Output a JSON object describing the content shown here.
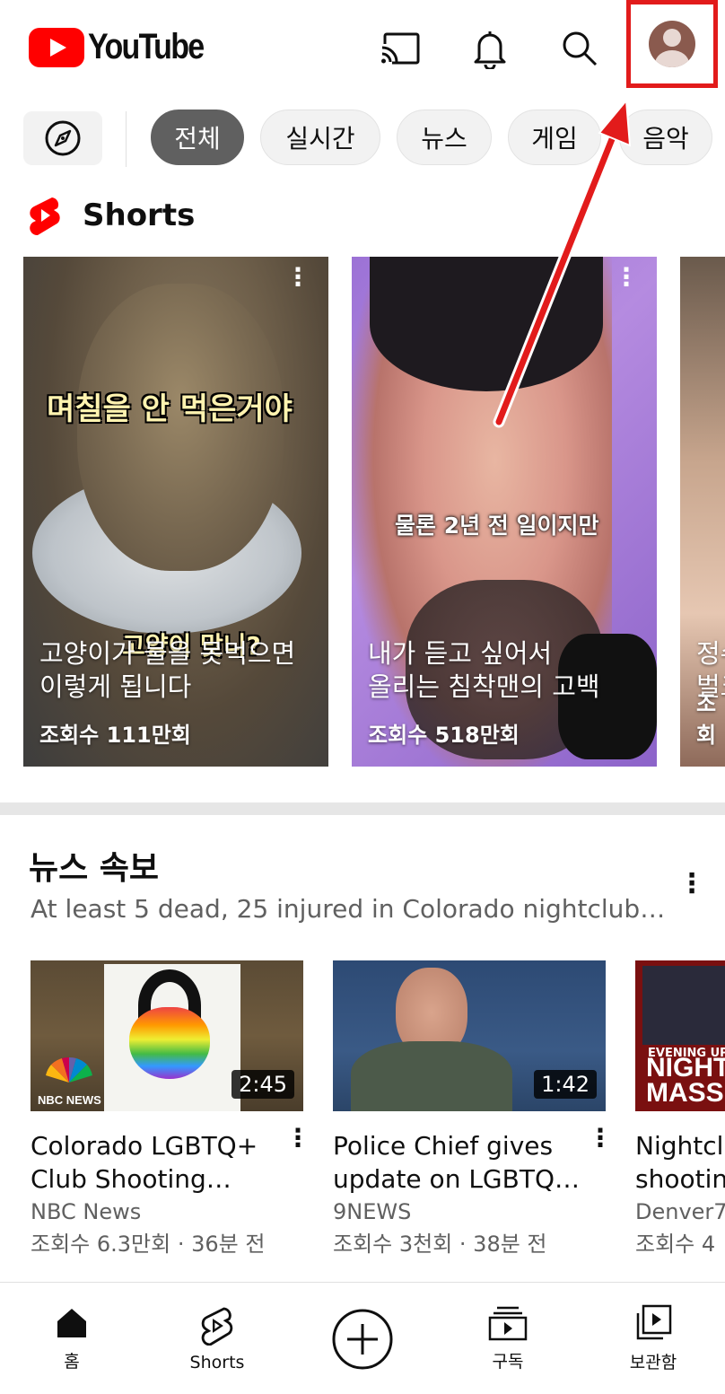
{
  "header": {
    "logo_text": "YouTube",
    "icons": [
      "cast-icon",
      "bell-icon",
      "search-icon",
      "avatar"
    ]
  },
  "chips": {
    "items": [
      "전체",
      "실시간",
      "뉴스",
      "게임",
      "음악"
    ],
    "active_index": 0
  },
  "shorts": {
    "title": "Shorts",
    "cards": [
      {
        "overlay_top": "며칠을 안 먹은거야",
        "overlay_bottom": "고양이 맞니?",
        "title_line1": "고양이가 물을 못먹으면",
        "title_line2": "이렇게 됩니다",
        "views": "조회수 111만회"
      },
      {
        "overlay_mid": "물론 2년 전 일이지만",
        "title_line1": "내가 듣고 싶어서",
        "title_line2": "올리는 침착맨의 고백",
        "views": "조회수 518만회"
      },
      {
        "title_line1": "정수",
        "title_line2": "벌크",
        "views": "조회"
      }
    ]
  },
  "news": {
    "title": "뉴스 속보",
    "subtitle": "At least 5 dead, 25 injured in Colorado nightclub…",
    "videos": [
      {
        "title_line1": "Colorado LGBTQ+",
        "title_line2": "Club Shooting…",
        "channel": "NBC News",
        "meta": "조회수 6.3만회 · 36분 전",
        "duration": "2:45",
        "thumb_logo": "NBC NEWS"
      },
      {
        "title_line1": "Police Chief gives",
        "title_line2": "update on LGBTQ…",
        "channel": "9NEWS",
        "meta": "조회수 3천회 · 38분 전",
        "duration": "1:42"
      },
      {
        "title_line1": "Nightcl",
        "title_line2": "shootin",
        "channel": "Denver7",
        "meta": "조회수 4",
        "thumb_text1": "EVENING UPD",
        "thumb_text2": "NIGHT",
        "thumb_text3": "MASS"
      }
    ]
  },
  "bottom_nav": {
    "items": [
      "홈",
      "Shorts",
      "",
      "구독",
      "보관함"
    ]
  },
  "colors": {
    "brand_red": "#ff0000",
    "annotation_red": "#e21b1b",
    "chip_active": "#606060"
  }
}
